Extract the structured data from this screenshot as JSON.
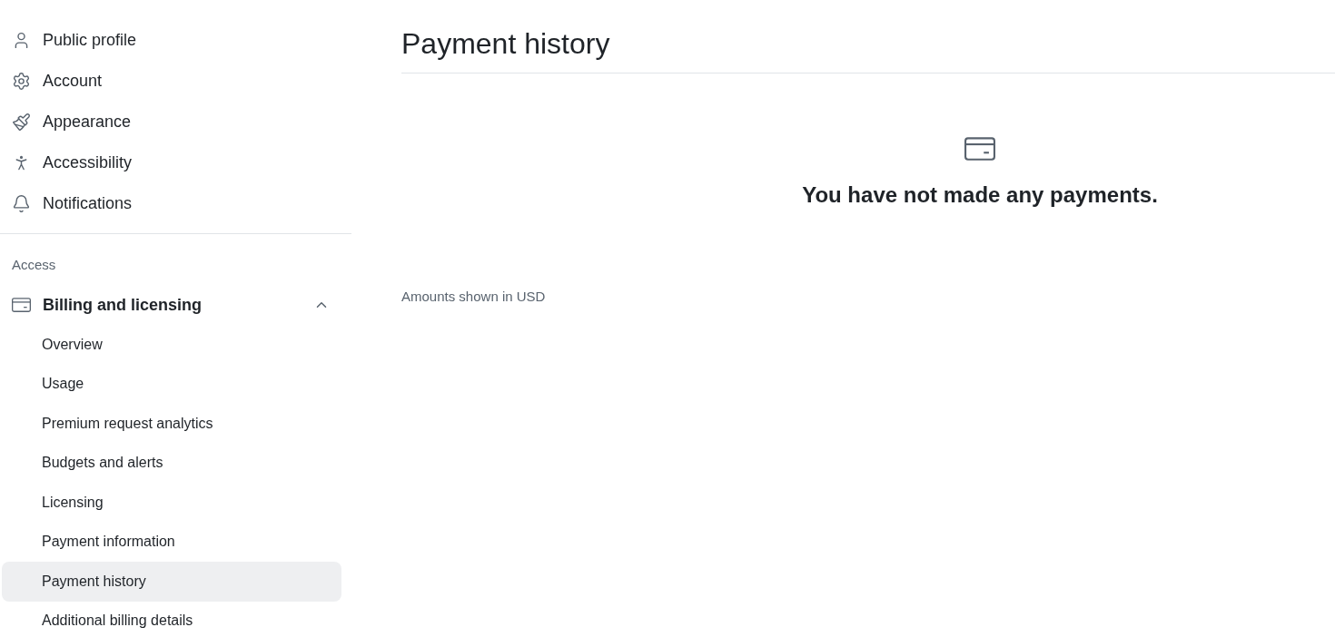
{
  "sidebar": {
    "items": [
      {
        "label": "Public profile"
      },
      {
        "label": "Account"
      },
      {
        "label": "Appearance"
      },
      {
        "label": "Accessibility"
      },
      {
        "label": "Notifications"
      }
    ],
    "sections": [
      {
        "heading": "Access",
        "group": {
          "label": "Billing and licensing",
          "expanded": true,
          "children": [
            {
              "label": "Overview",
              "selected": false
            },
            {
              "label": "Usage",
              "selected": false
            },
            {
              "label": "Premium request analytics",
              "selected": false
            },
            {
              "label": "Budgets and alerts",
              "selected": false
            },
            {
              "label": "Licensing",
              "selected": false
            },
            {
              "label": "Payment information",
              "selected": false
            },
            {
              "label": "Payment history",
              "selected": true
            },
            {
              "label": "Additional billing details",
              "selected": false
            }
          ]
        }
      }
    ]
  },
  "main": {
    "title": "Payment history",
    "empty_state": {
      "message": "You have not made any payments."
    },
    "footnote": "Amounts shown in USD"
  }
}
